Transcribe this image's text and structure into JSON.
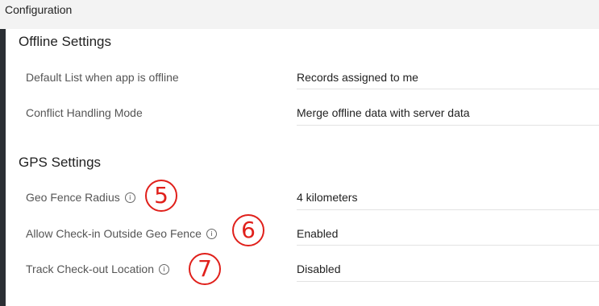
{
  "header": {
    "title": "Configuration"
  },
  "offline_settings": {
    "title": "Offline Settings",
    "rows": [
      {
        "label": "Default List when app is offline",
        "value": "Records assigned to me"
      },
      {
        "label": "Conflict Handling Mode",
        "value": "Merge offline data with server data"
      }
    ]
  },
  "gps_settings": {
    "title": "GPS Settings",
    "rows": [
      {
        "label": "Geo Fence Radius",
        "value": "4 kilometers",
        "callout": "5"
      },
      {
        "label": "Allow Check-in Outside Geo Fence",
        "value": "Enabled",
        "callout": "6"
      },
      {
        "label": "Track Check-out Location",
        "value": "Disabled",
        "callout": "7"
      }
    ]
  },
  "icons": {
    "info": "info-icon"
  },
  "colors": {
    "callout": "#e0201b",
    "rail": "#2b2f34",
    "header_bg": "#f3f3f3"
  }
}
